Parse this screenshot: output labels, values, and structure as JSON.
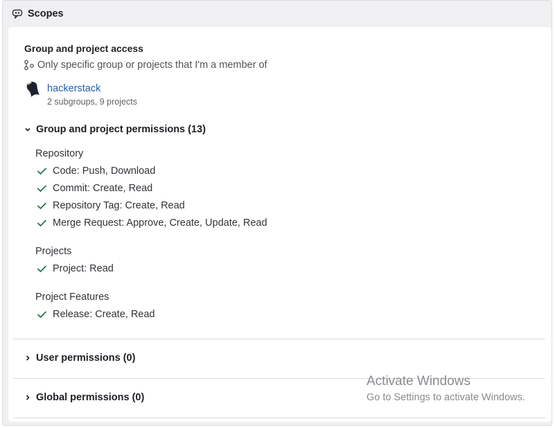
{
  "header": {
    "title": "Scopes",
    "icon": "scopes-icon"
  },
  "access": {
    "title": "Group and project access",
    "description": "Only specific group or projects that I'm a member of",
    "icon": "group-icon"
  },
  "group": {
    "name": "hackerstack",
    "meta": "2 subgroups, 9 projects",
    "avatar": "eagle-avatar"
  },
  "sections": {
    "group_project": {
      "label": "Group and project permissions (13)",
      "expanded": true
    },
    "user": {
      "label": "User permissions (0)",
      "expanded": false
    },
    "global": {
      "label": "Global permissions (0)",
      "expanded": false
    }
  },
  "categories": [
    {
      "name": "Repository",
      "permissions": [
        "Code: Push, Download",
        "Commit: Create, Read",
        "Repository Tag: Create, Read",
        "Merge Request: Approve, Create, Update, Read"
      ]
    },
    {
      "name": "Projects",
      "permissions": [
        "Project: Read"
      ]
    },
    {
      "name": "Project Features",
      "permissions": [
        "Release: Create, Read"
      ]
    }
  ],
  "watermark": {
    "title": "Activate Windows",
    "subtitle": "Go to Settings to activate Windows."
  },
  "colors": {
    "check": "#217645",
    "link": "#1f5fb0"
  }
}
